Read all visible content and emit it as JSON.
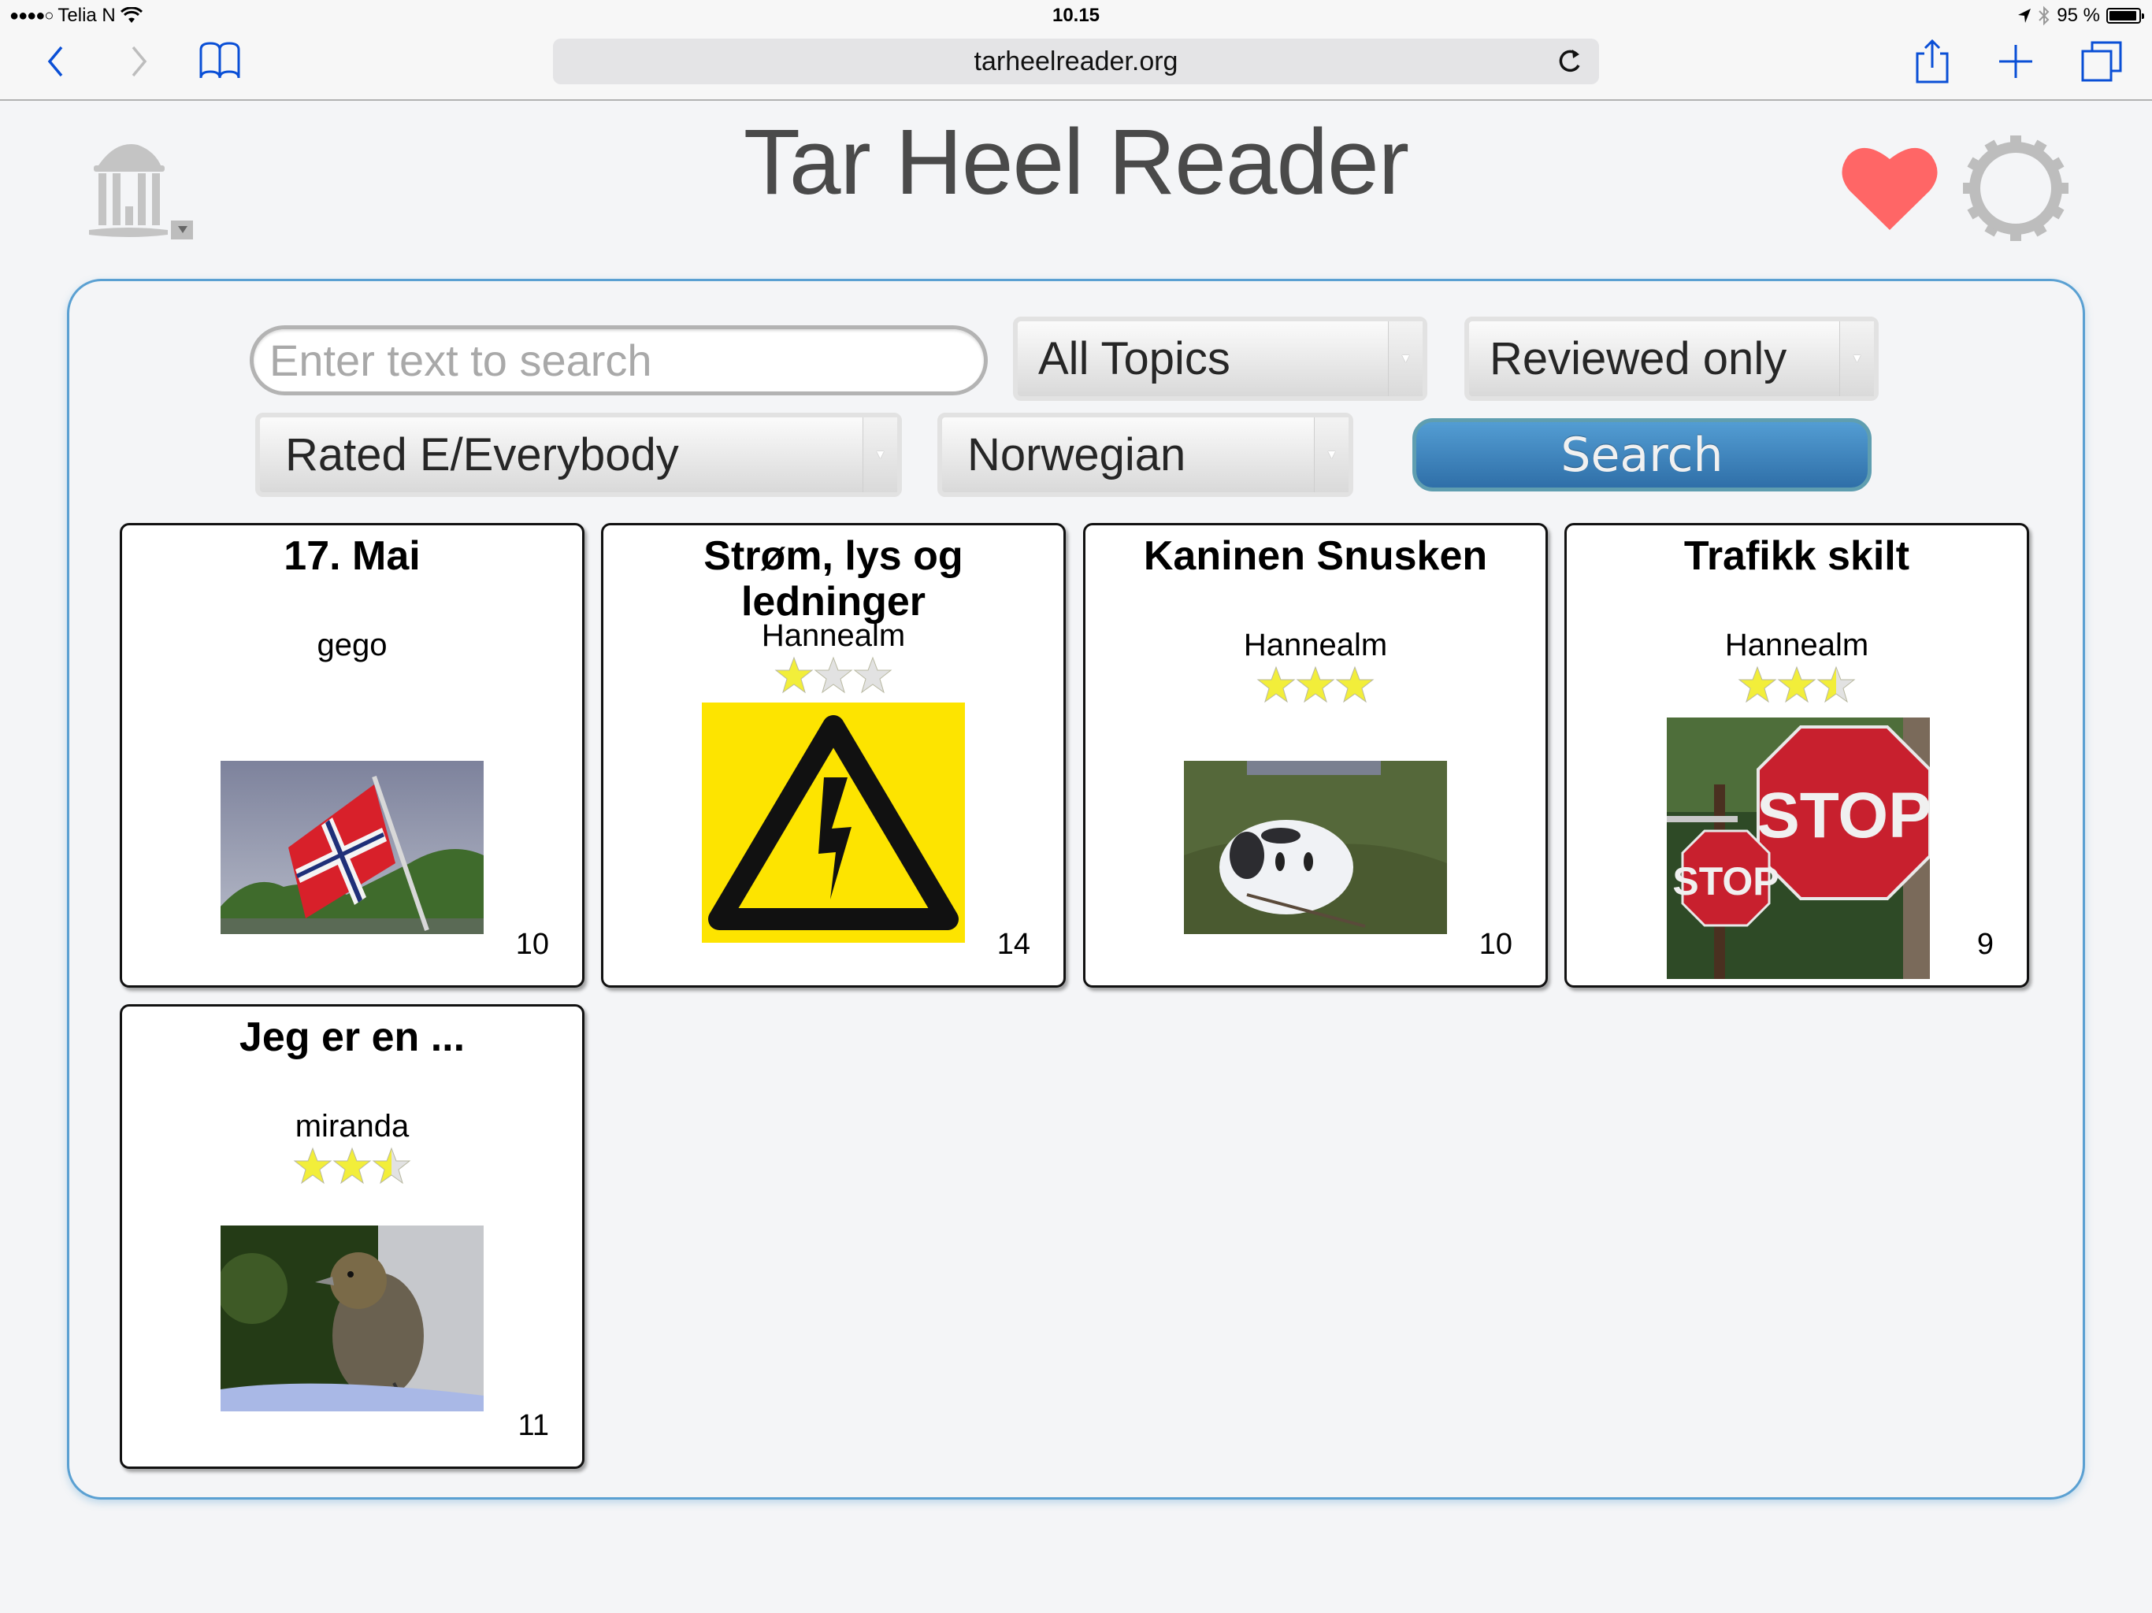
{
  "status_bar": {
    "carrier": "Telia N",
    "time": "10.15",
    "battery_percent": "95 %",
    "battery_level": 0.95
  },
  "browser": {
    "url": "tarheelreader.org",
    "icons": [
      "back-icon",
      "forward-icon",
      "bookmarks-icon",
      "reload-icon",
      "share-icon",
      "new-tab-icon",
      "tabs-icon"
    ]
  },
  "header": {
    "title": "Tar Heel Reader",
    "logo_icon": "old-well-logo",
    "favorites_icon": "heart-icon",
    "settings_icon": "gear-icon"
  },
  "search": {
    "input_value": "",
    "input_placeholder": "Enter text to search",
    "topic_select": "All Topics",
    "review_select": "Reviewed only",
    "rating_select": "Rated E/Everybody",
    "language_select": "Norwegian",
    "search_button": "Search"
  },
  "books": [
    {
      "title": "17. Mai",
      "author": "gego",
      "rating": null,
      "pages": "10",
      "image": "norwegian-flag"
    },
    {
      "title": "Strøm, lys og ledninger",
      "author": "Hannealm",
      "rating": 1,
      "pages": "14",
      "image": "electric-hazard-sign"
    },
    {
      "title": "Kaninen Snusken",
      "author": "Hannealm",
      "rating": 3,
      "pages": "10",
      "image": "rabbit"
    },
    {
      "title": "Trafikk skilt",
      "author": "Hannealm",
      "rating": 2.5,
      "pages": "9",
      "image": "stop-signs"
    },
    {
      "title": "Jeg er en ...",
      "author": "miranda",
      "rating": 2.5,
      "pages": "11",
      "image": "bird"
    }
  ],
  "rating_max": 3,
  "colors": {
    "accent_blue": "#3a82bf",
    "panel_border": "#5aa0d2",
    "heart": "#ff6666",
    "ios_blue": "#0a4fd6",
    "star_filled": "#f2ee3a",
    "star_empty": "#e2e2e2"
  }
}
